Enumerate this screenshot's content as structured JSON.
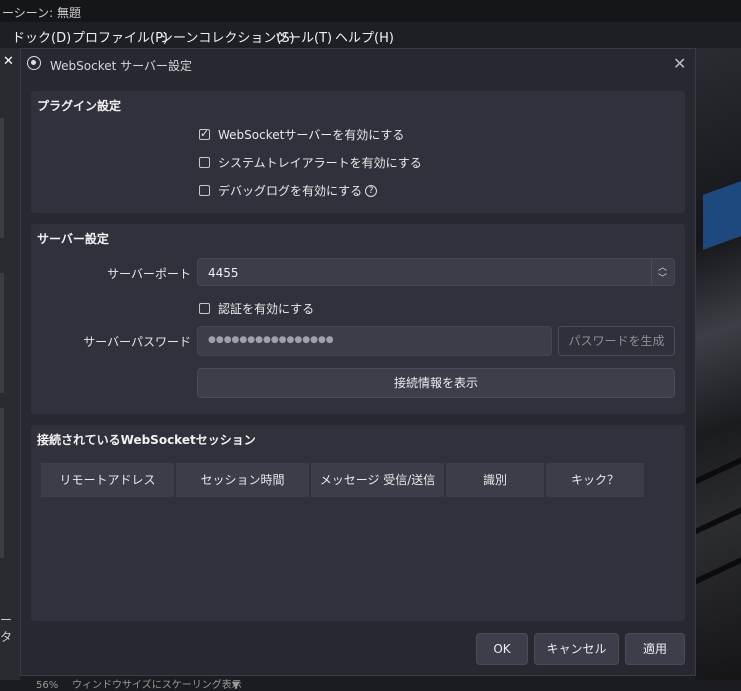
{
  "background": {
    "window_title": "ーシーン: 無題",
    "menu": [
      "ドック(D)",
      "プロファイル(P)",
      "シーンコレクション(S)",
      "ツール(T)",
      "ヘルプ(H)"
    ],
    "left_fragment": "ータ",
    "status_zoom": "56%",
    "status_text": "ウィンドウサイズにスケーリング表示"
  },
  "dialog": {
    "title": "WebSocket サーバー設定",
    "plugin_settings": {
      "heading": "プラグイン設定",
      "enable_server": "WebSocketサーバーを有効にする",
      "enable_server_checked": true,
      "tray_alerts": "システムトレイアラートを有効にする",
      "tray_alerts_checked": false,
      "debug_log": "デバッグログを有効にする",
      "debug_log_checked": false
    },
    "server_settings": {
      "heading": "サーバー設定",
      "port_label": "サーバーポート",
      "port_value": "4455",
      "auth_label": "認証を有効にする",
      "auth_checked": false,
      "password_label": "サーバーパスワード",
      "password_value": "●●●●●●●●●●●●●●●●",
      "generate_button": "パスワードを生成",
      "show_info_button": "接続情報を表示"
    },
    "sessions": {
      "heading": "接続されているWebSocketセッション",
      "columns": [
        "リモートアドレス",
        "セッション時間",
        "メッセージ 受信/送信",
        "識別",
        "キック？"
      ]
    },
    "buttons": {
      "ok": "OK",
      "cancel": "キャンセル",
      "apply": "適用"
    }
  }
}
